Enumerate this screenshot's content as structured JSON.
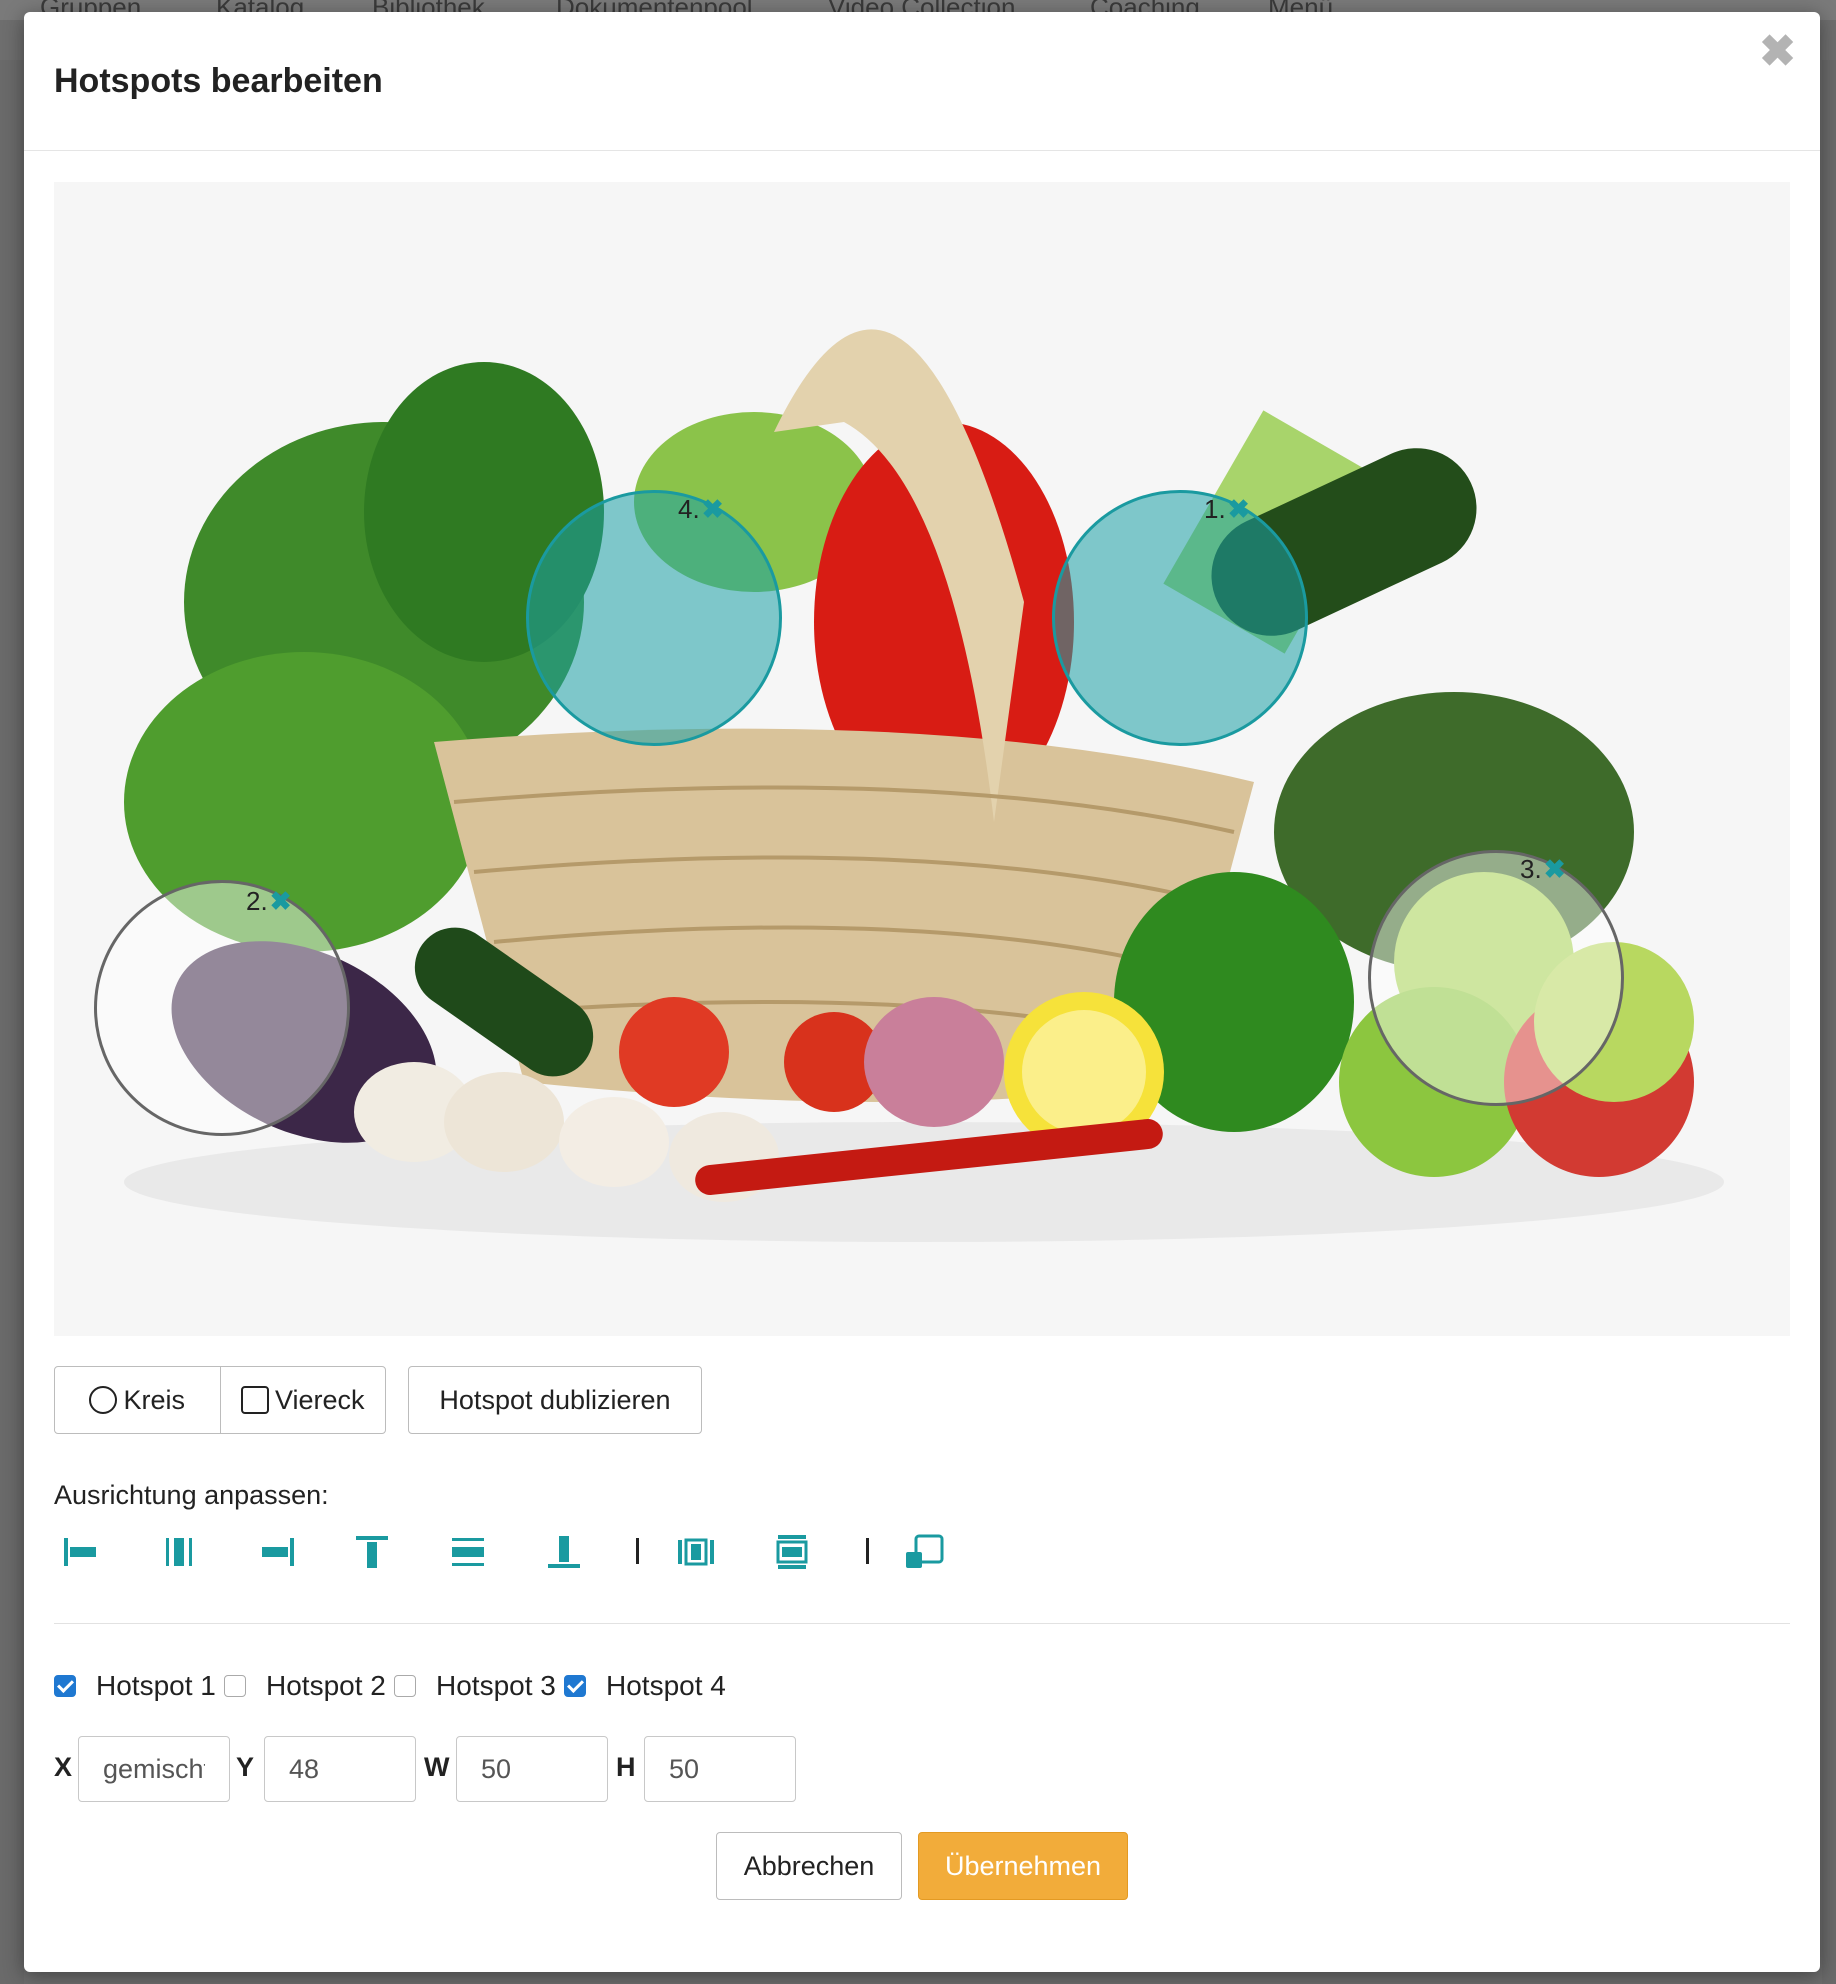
{
  "background": {
    "nav_items": [
      "Gruppen",
      "Katalog",
      "Bibliothek",
      "Dokumentenpool",
      "Video Collection",
      "Coaching",
      "Menü"
    ]
  },
  "modal": {
    "title": "Hotspots bearbeiten",
    "close_icon": "close-icon"
  },
  "hotspots": [
    {
      "label": "1.",
      "selected": true
    },
    {
      "label": "2.",
      "selected": false
    },
    {
      "label": "3.",
      "selected": false
    },
    {
      "label": "4.",
      "selected": true
    }
  ],
  "toolbar": {
    "circle_label": "Kreis",
    "rect_label": "Viereck",
    "duplicate_label": "Hotspot dublizieren"
  },
  "alignment": {
    "label": "Ausrichtung anpassen:",
    "icons": [
      "align-left-icon",
      "align-center-horizontal-icon",
      "align-right-icon",
      "align-top-icon",
      "align-middle-vertical-icon",
      "align-bottom-icon",
      "distribute-horizontal-icon",
      "distribute-vertical-icon",
      "same-size-icon"
    ]
  },
  "hotspot_checks": [
    {
      "label": "Hotspot 1",
      "checked": true
    },
    {
      "label": "Hotspot 2",
      "checked": false
    },
    {
      "label": "Hotspot 3",
      "checked": false
    },
    {
      "label": "Hotspot 4",
      "checked": true
    }
  ],
  "coords": {
    "x_label": "X",
    "x_value": "gemischt",
    "y_label": "Y",
    "y_value": "48",
    "w_label": "W",
    "w_value": "50",
    "h_label": "H",
    "h_value": "50"
  },
  "footer": {
    "cancel_label": "Abbrechen",
    "apply_label": "Übernehmen"
  },
  "colors": {
    "accent": "#1a9aa0",
    "apply": "#f2ac3a",
    "checkbox": "#1f78d1"
  }
}
